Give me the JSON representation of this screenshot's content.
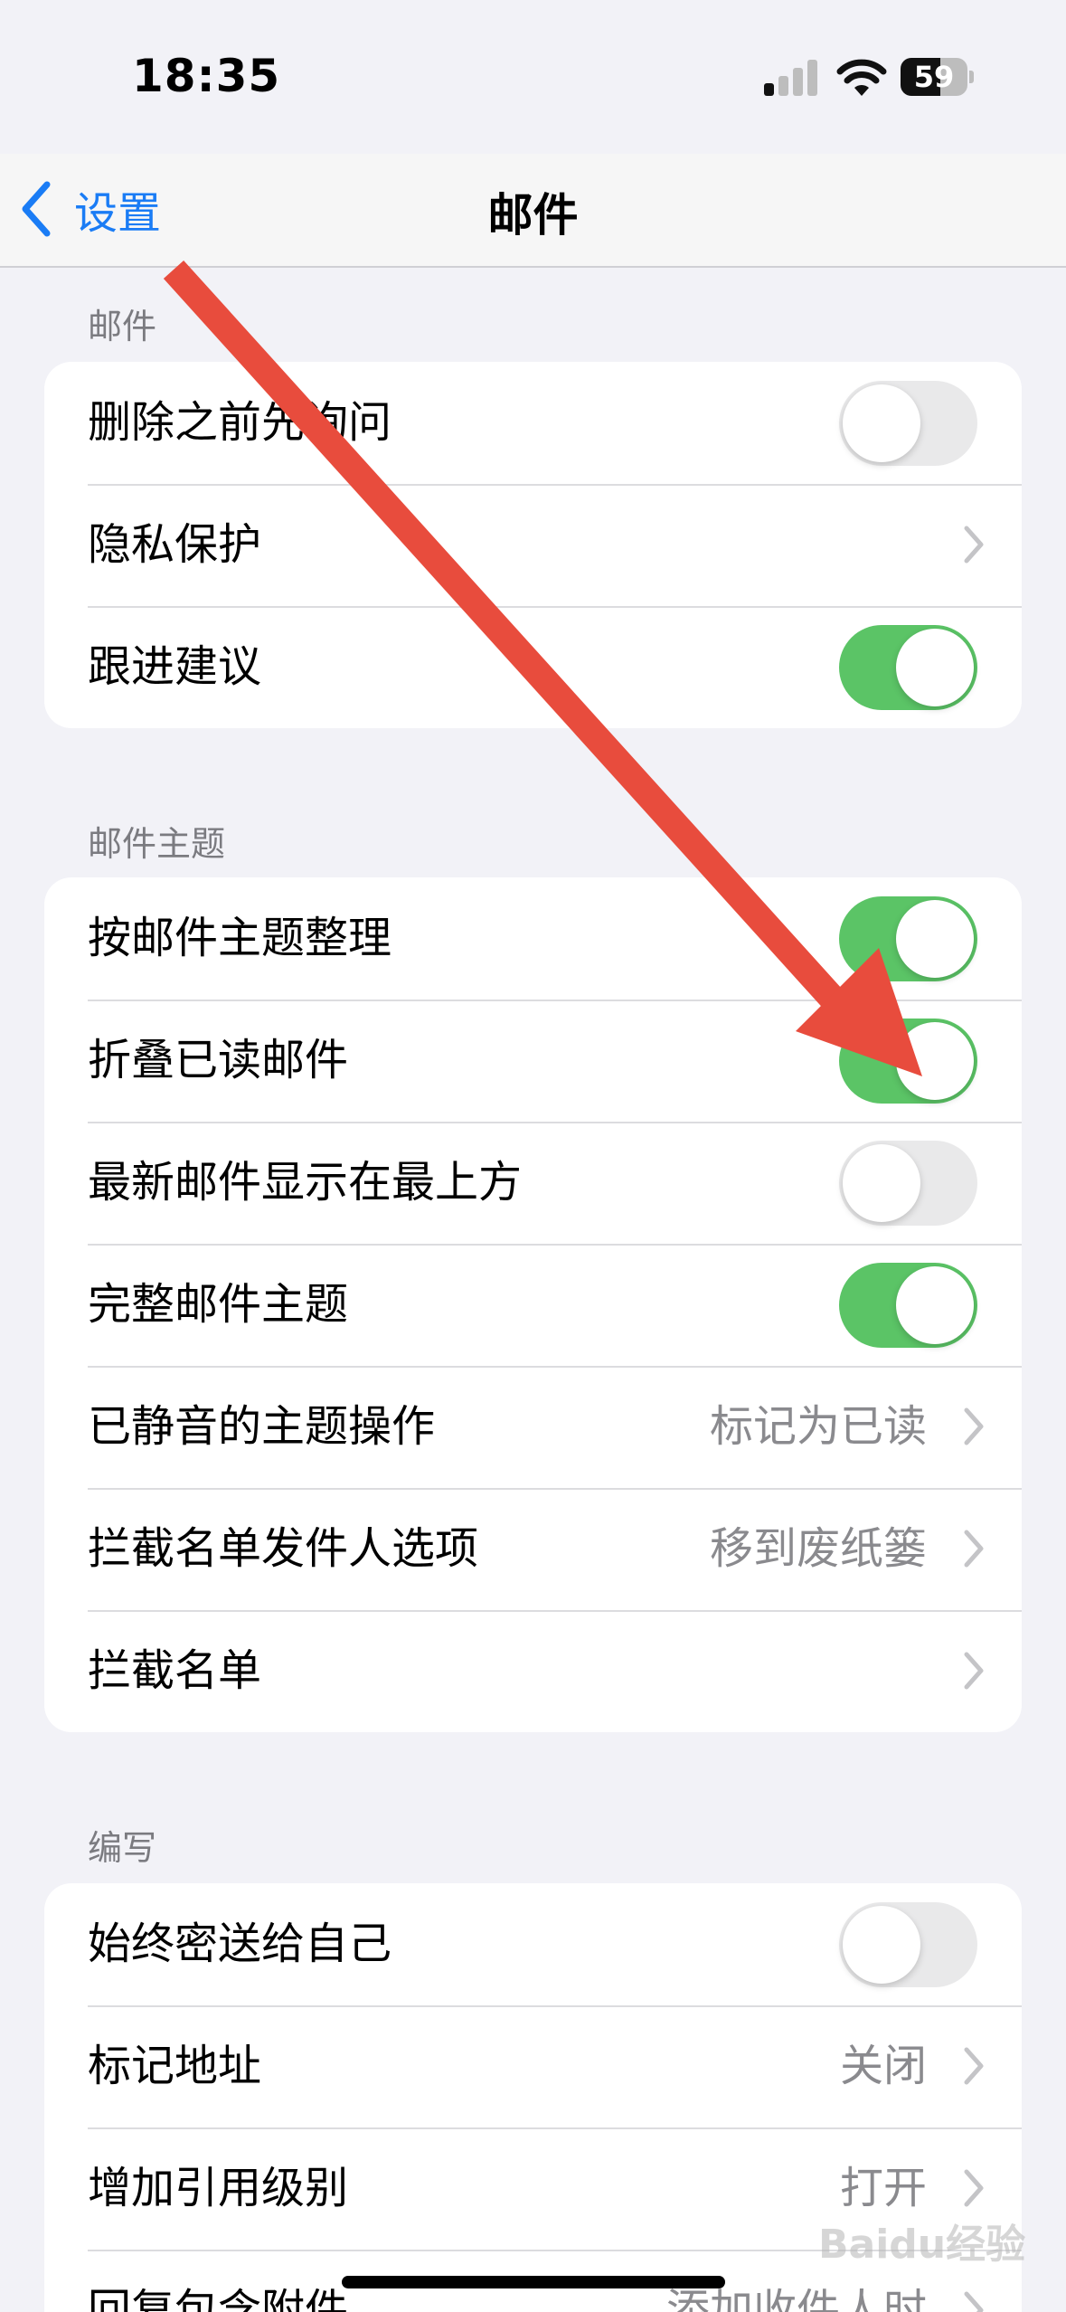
{
  "status": {
    "time": "18:35",
    "battery": "59"
  },
  "nav": {
    "back_label": "设置",
    "title": "邮件"
  },
  "sections": [
    {
      "header": "邮件",
      "rows": [
        {
          "label": "删除之前先询问",
          "control": "toggle",
          "on": false
        },
        {
          "label": "隐私保护",
          "control": "chevron"
        },
        {
          "label": "跟进建议",
          "control": "toggle",
          "on": true
        }
      ]
    },
    {
      "header": "邮件主题",
      "rows": [
        {
          "label": "按邮件主题整理",
          "control": "toggle",
          "on": true
        },
        {
          "label": "折叠已读邮件",
          "control": "toggle",
          "on": true
        },
        {
          "label": "最新邮件显示在最上方",
          "control": "toggle",
          "on": false
        },
        {
          "label": "完整邮件主题",
          "control": "toggle",
          "on": true
        },
        {
          "label": "已静音的主题操作",
          "control": "chevron",
          "value": "标记为已读"
        },
        {
          "label": "拦截名单发件人选项",
          "control": "chevron",
          "value": "移到废纸篓"
        },
        {
          "label": "拦截名单",
          "control": "chevron"
        }
      ]
    },
    {
      "header": "编写",
      "rows": [
        {
          "label": "始终密送给自己",
          "control": "toggle",
          "on": false
        },
        {
          "label": "标记地址",
          "control": "chevron",
          "value": "关闭"
        },
        {
          "label": "增加引用级别",
          "control": "chevron",
          "value": "打开"
        },
        {
          "label": "回复包含附件",
          "control": "chevron",
          "value": "添加收件人时"
        }
      ]
    }
  ],
  "watermark": "Baidu经验",
  "colors": {
    "accent": "#1a7cf5",
    "toggle_on": "#5bc466",
    "arrow": "#e84c3d"
  }
}
